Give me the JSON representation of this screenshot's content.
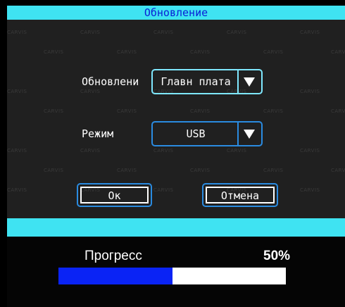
{
  "dialog": {
    "title": "Обновление",
    "watermark": "CARVIS",
    "update_label": "Обновлени",
    "update_value": "Главн плата",
    "mode_label": "Режим",
    "mode_value": "USB",
    "ok_label": "Ок",
    "cancel_label": "Отмена"
  },
  "progress": {
    "title": "Прогресс",
    "percent_text": "50%",
    "value": 0.5
  },
  "colors": {
    "title_bar": "#3fe3f2",
    "title_text": "#0a1fd6",
    "accent_border": "#2a8be0",
    "focused_border": "#7fe8ff",
    "progress_fill": "#0a23f5"
  },
  "icons": {
    "dropdown": "triangle-down-icon"
  }
}
